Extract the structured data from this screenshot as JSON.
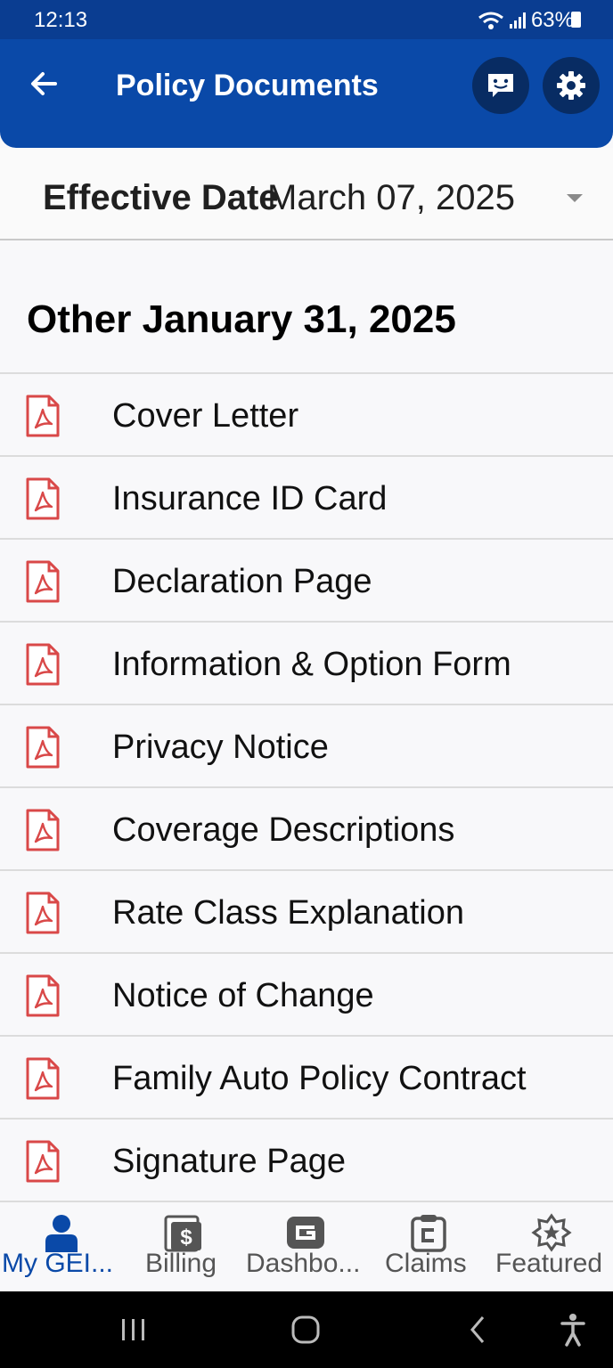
{
  "status_bar": {
    "time": "12:13",
    "battery": "63%"
  },
  "header": {
    "title": "Policy Documents",
    "back_icon": "arrow-left-icon",
    "chat_icon": "chat-bubble-icon",
    "settings_icon": "gear-icon",
    "color": "#0a49a8"
  },
  "effective_date": {
    "label": "Effective Date",
    "value": "March 07, 2025"
  },
  "section": {
    "title": "Other January 31, 2025"
  },
  "documents": [
    {
      "label": "Cover Letter"
    },
    {
      "label": "Insurance ID Card"
    },
    {
      "label": "Declaration Page"
    },
    {
      "label": "Information & Option Form"
    },
    {
      "label": "Privacy Notice"
    },
    {
      "label": "Coverage Descriptions"
    },
    {
      "label": "Rate Class Explanation"
    },
    {
      "label": "Notice of Change"
    },
    {
      "label": "Family Auto Policy Contract"
    },
    {
      "label": "Signature Page"
    }
  ],
  "bottom_nav": [
    {
      "label": "My GEI...",
      "icon": "person-icon",
      "active": true
    },
    {
      "label": "Billing",
      "icon": "bill-icon",
      "active": false
    },
    {
      "label": "Dashbo...",
      "icon": "geico-g-icon",
      "active": false
    },
    {
      "label": "Claims",
      "icon": "clipboard-icon",
      "active": false
    },
    {
      "label": "Featured",
      "icon": "star-badge-icon",
      "active": false
    }
  ],
  "colors": {
    "pdf_icon": "#d94848",
    "active_nav": "#0a49a8"
  }
}
